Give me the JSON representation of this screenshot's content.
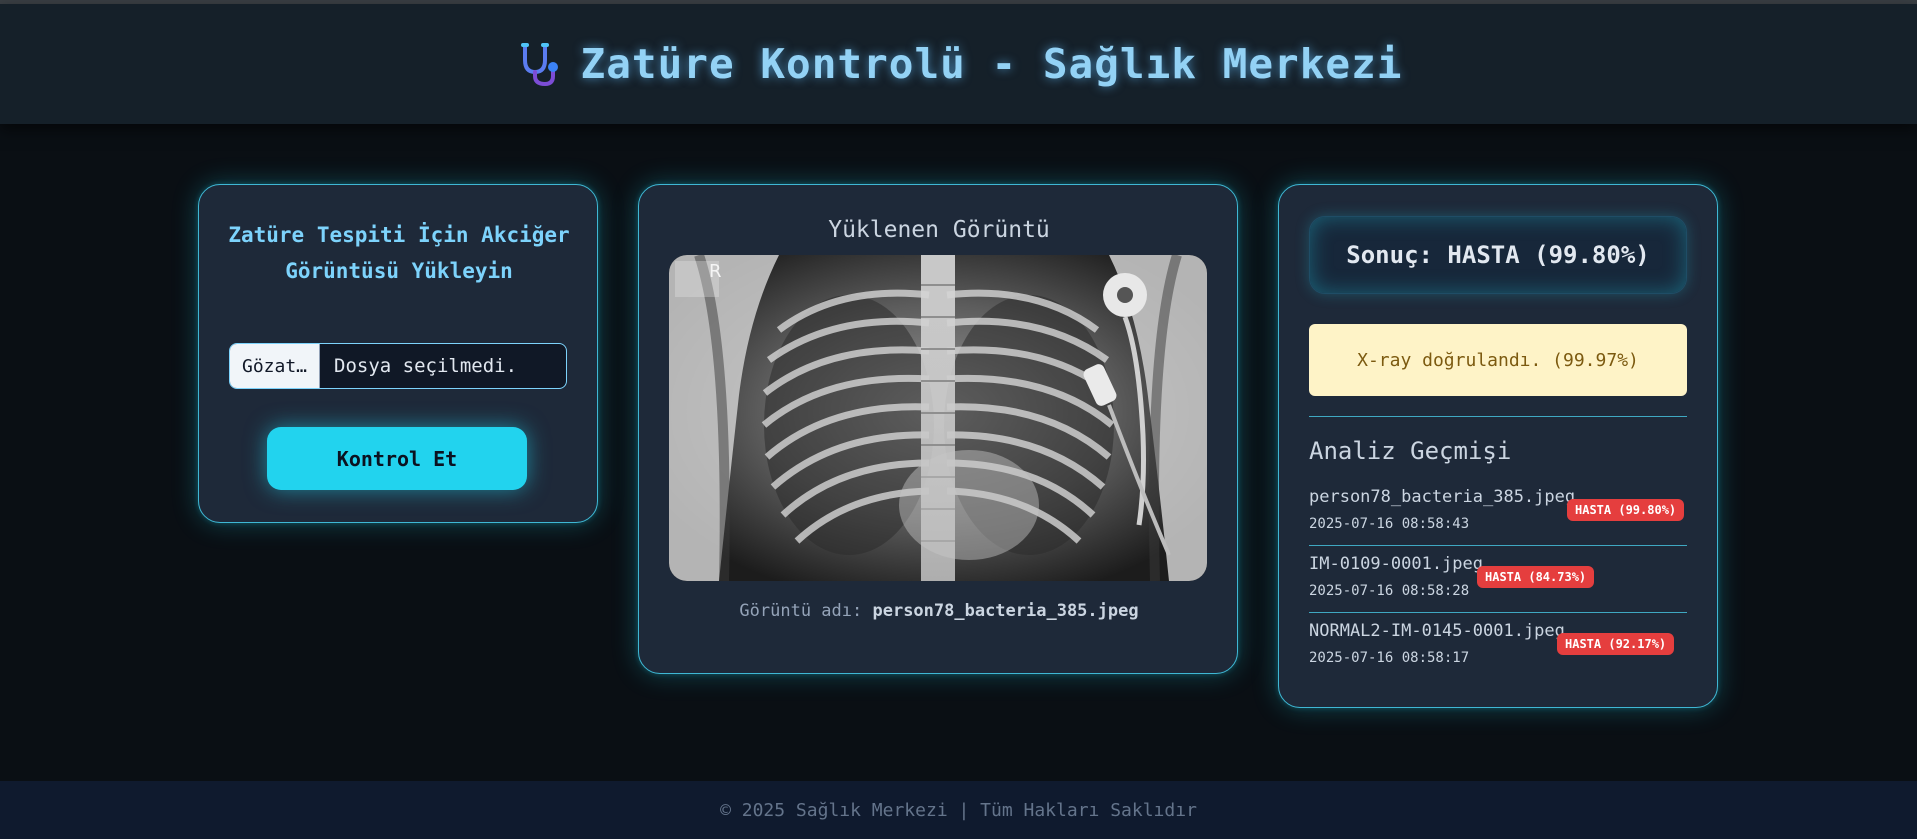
{
  "header": {
    "title": "Zatüre Kontrolü - Sağlık Merkezi",
    "icon": "stethoscope-icon"
  },
  "upload": {
    "title": "Zatüre Tespiti İçin Akciğer Görüntüsü Yükleyin",
    "browse_label": "Gözat…",
    "file_status": "Dosya seçilmedi.",
    "submit_label": "Kontrol Et"
  },
  "image": {
    "title": "Yüklenen Görüntü",
    "caption_label": "Görüntü adı:",
    "file_name": "person78_bacteria_385.jpeg",
    "marker": "R"
  },
  "result": {
    "text": "Sonuç: HASTA (99.80%)",
    "verification": "X-ray doğrulandı. (99.97%)"
  },
  "history": {
    "title": "Analiz Geçmişi",
    "items": [
      {
        "file": "person78_bacteria_385.jpeg",
        "time": "2025-07-16 08:58:43",
        "badge": "HASTA (99.80%)"
      },
      {
        "file": "IM-0109-0001.jpeg",
        "time": "2025-07-16 08:58:28",
        "badge": "HASTA (84.73%)"
      },
      {
        "file": "NORMAL2-IM-0145-0001.jpeg",
        "time": "2025-07-16 08:58:17",
        "badge": "HASTA (92.17%)"
      }
    ]
  },
  "footer": {
    "text": "© 2025 Sağlık Merkezi | Tüm Hakları Saklıdır"
  },
  "colors": {
    "accent": "#22d3ee",
    "title": "#93d2f5",
    "badge": "#e53e3e",
    "warning_bg": "#fef3c7"
  }
}
